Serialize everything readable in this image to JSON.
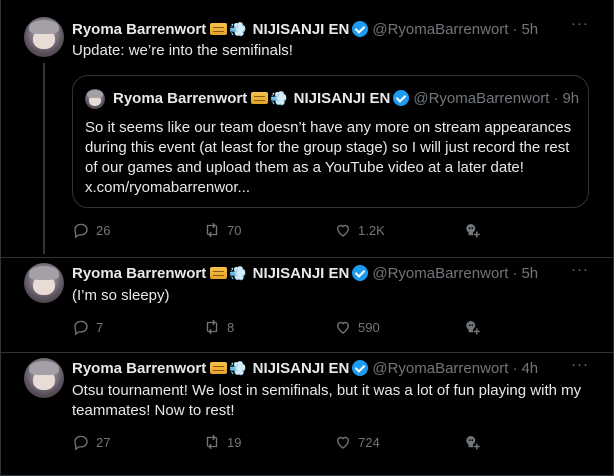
{
  "tweets": [
    {
      "name": "Ryoma Barrenwort",
      "org": "NIJISANJI EN",
      "handle": "@RyomaBarrenwort",
      "separator": "·",
      "time": "5h",
      "text": "Update: we’re into the semifinals!",
      "quote": {
        "name": "Ryoma Barrenwort",
        "org": "NIJISANJI EN",
        "handle": "@RyomaBarrenwort",
        "separator": "·",
        "time": "9h",
        "text": "So it seems like our team doesn’t have any more on stream appearances during this event (at least for the group stage) so I will just record the rest of our games and upload them as a YouTube video at a later date! x.com/ryomabarrenwor..."
      },
      "replies": "26",
      "reposts": "70",
      "likes": "1.2K"
    },
    {
      "name": "Ryoma Barrenwort",
      "org": "NIJISANJI EN",
      "handle": "@RyomaBarrenwort",
      "separator": "·",
      "time": "5h",
      "text": "(I’m so sleepy)",
      "replies": "7",
      "reposts": "8",
      "likes": "590"
    },
    {
      "name": "Ryoma Barrenwort",
      "org": "NIJISANJI EN",
      "handle": "@RyomaBarrenwort",
      "separator": "·",
      "time": "4h",
      "text": "Otsu tournament! We lost in semifinals, but it was a lot of fun playing with my teammates! Now to rest!",
      "replies": "27",
      "reposts": "19",
      "likes": "724"
    }
  ],
  "icons": {
    "emoji_1": "credit-card-emoji",
    "emoji_2": "dashing-away-emoji",
    "verified": "verified-badge-icon",
    "more": "more-icon",
    "reply": "reply-icon",
    "repost": "repost-icon",
    "like": "like-icon",
    "grok": "grok-icon"
  },
  "colors": {
    "background": "#000000",
    "text": "#e7e9ea",
    "muted": "#71767b",
    "verified": "#1d9bf0",
    "border": "#2f3336"
  }
}
